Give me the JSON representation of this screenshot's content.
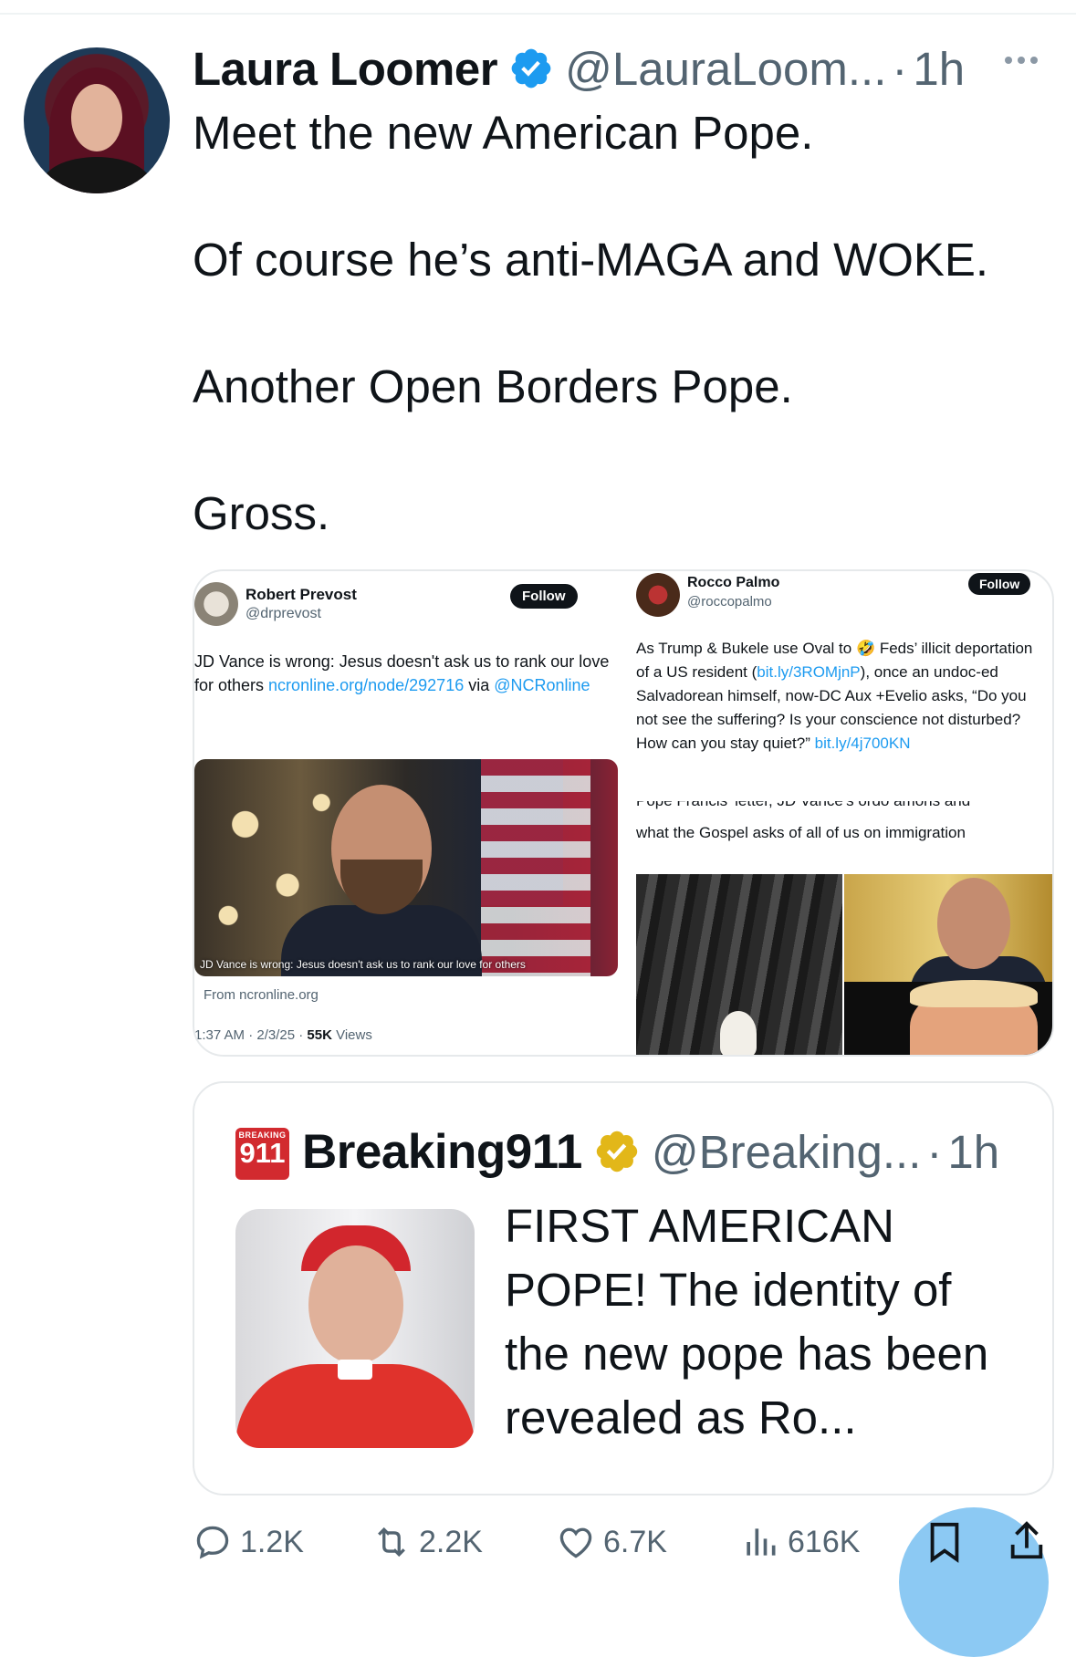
{
  "post": {
    "author_name": "Laura Loomer",
    "author_handle": "@LauraLoom...",
    "separator": "·",
    "time": "1h",
    "text_paragraphs": [
      "Meet the new American Pope.",
      "Of course he’s anti-MAGA and WOKE.",
      "Another Open Borders Pope.",
      "Gross."
    ]
  },
  "media": {
    "left": {
      "name": "Robert Prevost",
      "handle": "@drprevost",
      "follow": "Follow",
      "text_before_link": "JD Vance is wrong: Jesus doesn't ask us to rank our love for others ",
      "link": "ncronline.org/node/292716",
      "text_after_link": " via ",
      "mention": "@NCRonline",
      "card_caption": "JD Vance is wrong: Jesus doesn't ask us to rank our love for others",
      "card_source": "From ncronline.org",
      "timestamp": "1:37 AM · 2/3/25 · ",
      "views_count": "55K",
      "views_label": " Views"
    },
    "right": {
      "name": "Rocco Palmo",
      "handle": "@roccopalmo",
      "follow": "Follow",
      "text_part1": "As Trump & Bukele use Oval to 🤣 Feds’ illicit deportation of a US resident (",
      "link1": "bit.ly/3ROMjnP",
      "text_part2": "), once an undoc-ed Salvadorean himself, now-DC Aux +Evelio asks, “Do you not see the suffering? Is your conscience not disturbed? How can you stay quiet?” ",
      "link2": "bit.ly/4j700KN",
      "cut_line": "Pope Francis' letter, JD Vance's ordo amoris and",
      "subline": "what the Gospel asks of all of us on immigration"
    }
  },
  "quote": {
    "logo_small": "BREAKING",
    "logo_big": "911",
    "name": "Breaking911",
    "handle": "@Breaking...",
    "separator": "·",
    "time": "1h",
    "text": "FIRST AMERICAN POPE! The identity of the new pope has been revealed as Ro..."
  },
  "actions": {
    "replies": "1.2K",
    "reposts": "2.2K",
    "likes": "6.7K",
    "views": "616K"
  },
  "colors": {
    "verified_blue": "#1d9bf0",
    "verified_gold": "#e2b719",
    "text_secondary": "#536471",
    "link": "#1d9bf0"
  },
  "icons": [
    "verified-badge-icon",
    "more-icon",
    "reply-icon",
    "repost-icon",
    "like-icon",
    "views-icon",
    "bookmark-icon",
    "share-icon"
  ]
}
